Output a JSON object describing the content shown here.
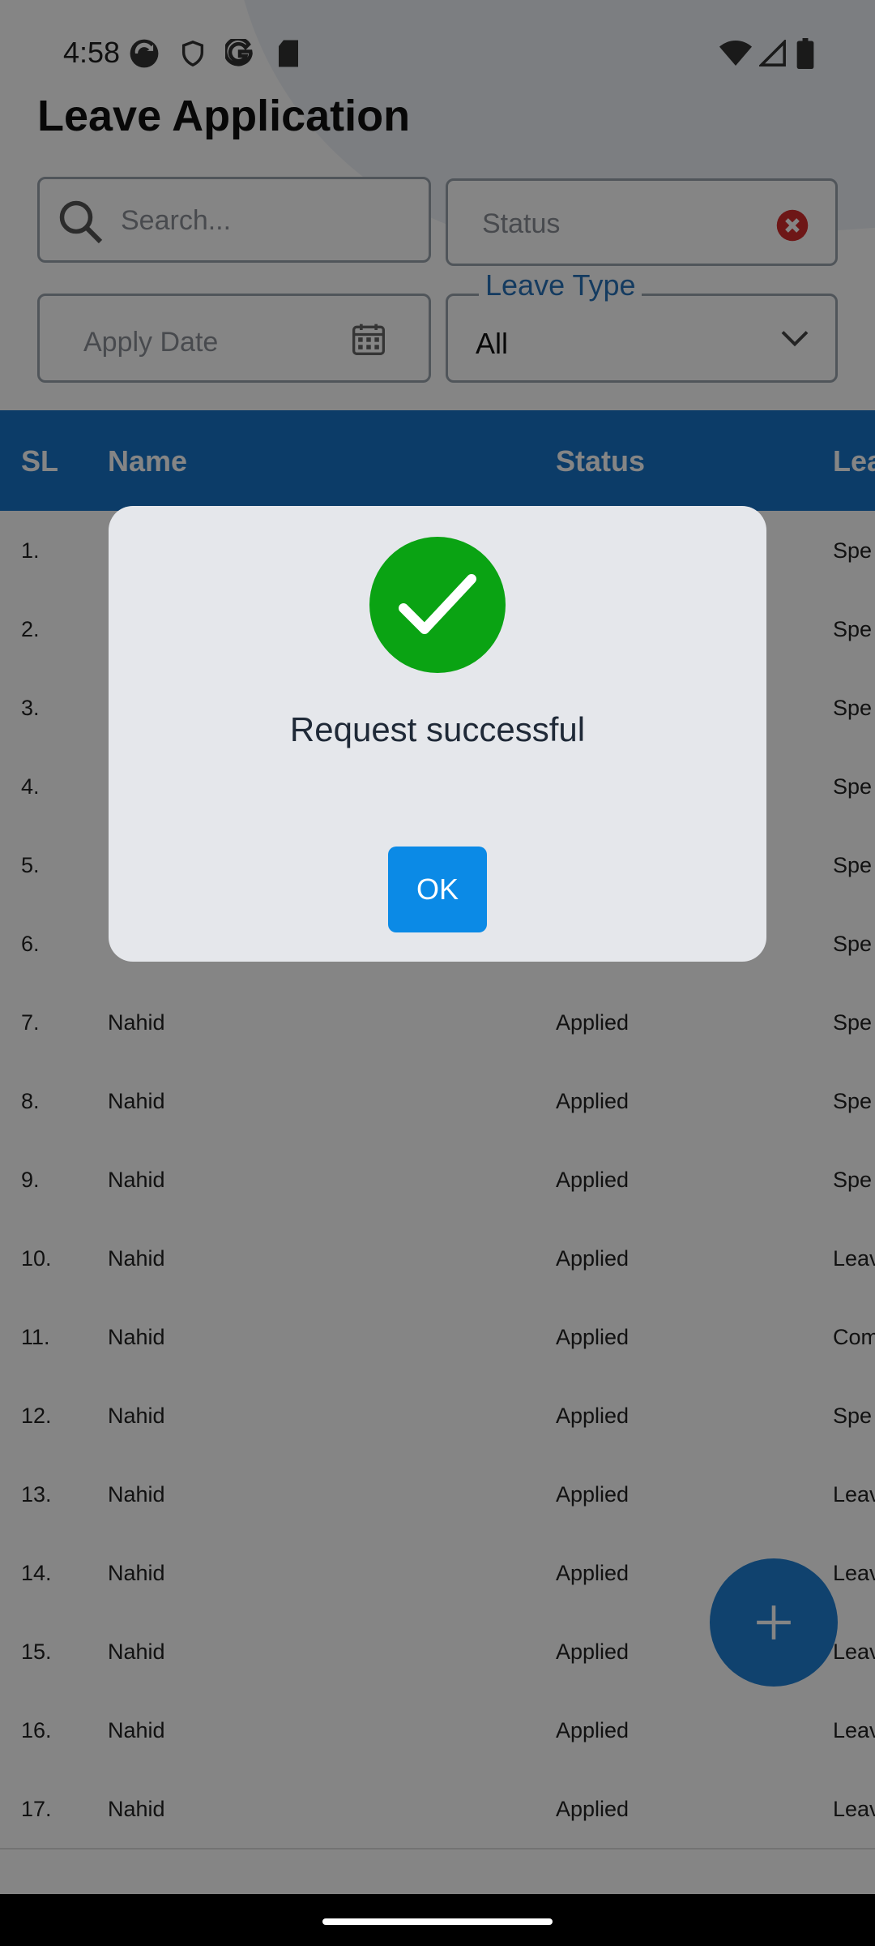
{
  "status_bar": {
    "time": "4:58",
    "icons": [
      "sync-icon",
      "shield-icon",
      "google-icon",
      "sd-card-icon",
      "wifi-icon",
      "signal-icon",
      "battery-icon"
    ]
  },
  "header": {
    "title": "Leave Application"
  },
  "filters": {
    "search_placeholder": "Search...",
    "status_placeholder": "Status",
    "apply_date_placeholder": "Apply Date",
    "leave_type_label": "Leave Type",
    "leave_type_value": "All"
  },
  "table": {
    "headers": {
      "sl": "SL",
      "name": "Name",
      "status": "Status",
      "type": "Lea"
    },
    "rows": [
      {
        "sl": "1.",
        "name": "",
        "status": "",
        "type": "Spe"
      },
      {
        "sl": "2.",
        "name": "",
        "status": "",
        "type": "Spe"
      },
      {
        "sl": "3.",
        "name": "",
        "status": "",
        "type": "Spe"
      },
      {
        "sl": "4.",
        "name": "",
        "status": "",
        "type": "Spe"
      },
      {
        "sl": "5.",
        "name": "",
        "status": "",
        "type": "Spe"
      },
      {
        "sl": "6.",
        "name": "",
        "status": "",
        "type": "Spe"
      },
      {
        "sl": "7.",
        "name": "Nahid",
        "status": "Applied",
        "type": "Spe"
      },
      {
        "sl": "8.",
        "name": "Nahid",
        "status": "Applied",
        "type": "Spe"
      },
      {
        "sl": "9.",
        "name": "Nahid",
        "status": "Applied",
        "type": "Spe"
      },
      {
        "sl": "10.",
        "name": "Nahid",
        "status": "Applied",
        "type": "Leav"
      },
      {
        "sl": "11.",
        "name": "Nahid",
        "status": "Applied",
        "type": "Com"
      },
      {
        "sl": "12.",
        "name": "Nahid",
        "status": "Applied",
        "type": "Spe"
      },
      {
        "sl": "13.",
        "name": "Nahid",
        "status": "Applied",
        "type": "Leav"
      },
      {
        "sl": "14.",
        "name": "Nahid",
        "status": "Applied",
        "type": "Leav"
      },
      {
        "sl": "15.",
        "name": "Nahid",
        "status": "Applied",
        "type": "Leav"
      },
      {
        "sl": "16.",
        "name": "Nahid",
        "status": "Applied",
        "type": "Leav"
      },
      {
        "sl": "17.",
        "name": "Nahid",
        "status": "Applied",
        "type": "Leav"
      }
    ]
  },
  "dialog": {
    "message": "Request successful",
    "ok_label": "OK"
  },
  "colors": {
    "accent": "#1774c8",
    "success": "#0aa313",
    "ok_button": "#0b8ae6",
    "clear_icon": "#d42c2c"
  }
}
